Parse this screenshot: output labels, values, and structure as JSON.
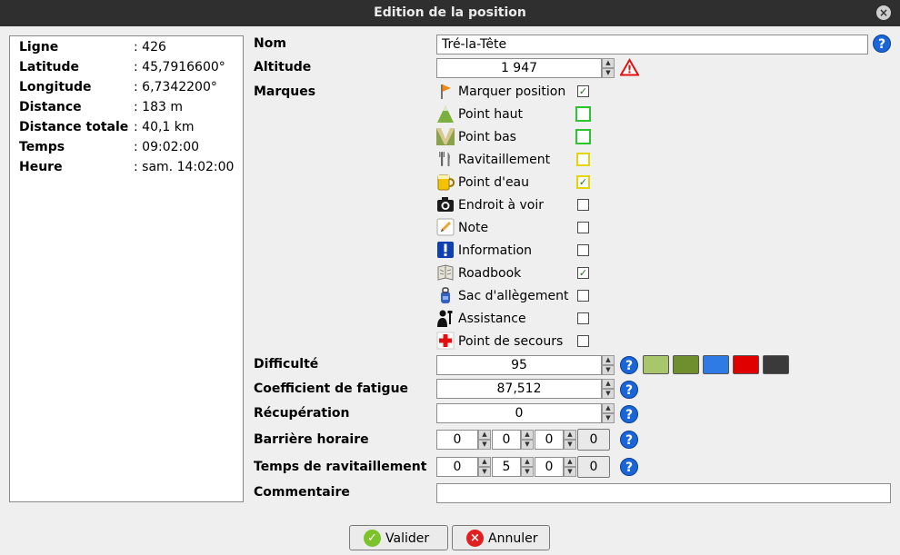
{
  "window": {
    "title": "Edition de la position",
    "close_icon": "close-icon"
  },
  "info": {
    "ligne_k": "Ligne",
    "ligne_v": ": 426",
    "latitude_k": "Latitude",
    "latitude_v": ": 45,7916600°",
    "longitude_k": "Longitude",
    "longitude_v": ": 6,7342200°",
    "distance_k": "Distance",
    "distance_v": ": 183 m",
    "distance_totale_k": "Distance totale",
    "distance_totale_v": ": 40,1 km",
    "temps_k": "Temps",
    "temps_v": ": 09:02:00",
    "heure_k": "Heure",
    "heure_v": ": sam. 14:02:00"
  },
  "form": {
    "nom_label": "Nom",
    "nom_value": "Tré-la-Tête",
    "altitude_label": "Altitude",
    "altitude_value": "1 947",
    "marques_label": "Marques",
    "difficulte_label": "Difficulté",
    "difficulte_value": "95",
    "fatigue_label": "Coefficient de fatigue",
    "fatigue_value": "87,512",
    "recuperation_label": "Récupération",
    "recuperation_value": "0",
    "barriere_label": "Barrière horaire",
    "barriere_h": "0",
    "barriere_m": "0",
    "barriere_s": "0",
    "barriere_btn": "0",
    "ravit_label": "Temps de ravitaillement",
    "ravit_h": "0",
    "ravit_m": "5",
    "ravit_s": "0",
    "ravit_btn": "0",
    "commentaire_label": "Commentaire",
    "commentaire_value": ""
  },
  "marques": {
    "marquer": {
      "label": "Marquer position",
      "checked": true,
      "icon": "flag-icon"
    },
    "haut": {
      "label": "Point haut",
      "checked": false,
      "icon": "mountain-icon"
    },
    "bas": {
      "label": "Point bas",
      "checked": false,
      "icon": "valley-icon"
    },
    "ravitaillement": {
      "label": "Ravitaillement",
      "checked": false,
      "icon": "fork-knife-icon"
    },
    "eau": {
      "label": "Point d'eau",
      "checked": true,
      "icon": "water-mug-icon"
    },
    "voir": {
      "label": "Endroit à voir",
      "checked": false,
      "icon": "camera-icon"
    },
    "note": {
      "label": "Note",
      "checked": false,
      "icon": "pencil-note-icon"
    },
    "information": {
      "label": "Information",
      "checked": false,
      "icon": "exclamation-icon"
    },
    "roadbook": {
      "label": "Roadbook",
      "checked": true,
      "icon": "roadbook-icon"
    },
    "sac": {
      "label": "Sac d'allègement",
      "checked": false,
      "icon": "bag-icon"
    },
    "assistance": {
      "label": "Assistance",
      "checked": false,
      "icon": "assistance-icon"
    },
    "secours": {
      "label": "Point de secours",
      "checked": false,
      "icon": "red-cross-icon"
    }
  },
  "difficulty_colors": [
    "#a8c66c",
    "#6f8f2f",
    "#2f7be6",
    "#e00000",
    "#3a3a3a"
  ],
  "buttons": {
    "valider": "Valider",
    "annuler": "Annuler"
  },
  "marks": {
    "check": "✓",
    "spin_up": "▲",
    "spin_down": "▼",
    "help": "?",
    "warn": "!",
    "close": "×",
    "cancel": "×"
  }
}
